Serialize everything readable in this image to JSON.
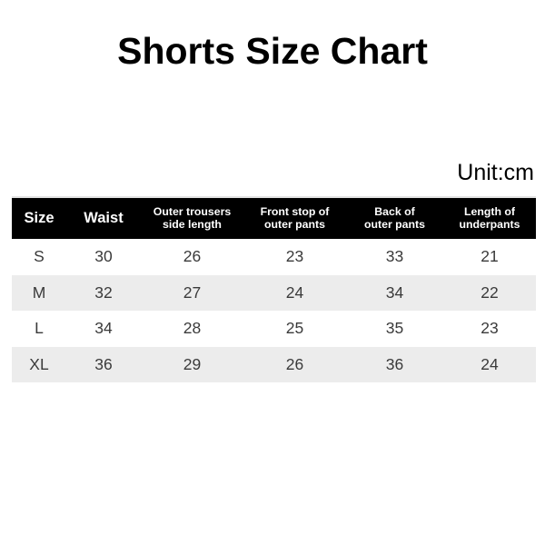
{
  "title": "Shorts Size Chart",
  "unit_note": "Unit:cm",
  "colors": {
    "header_background": "#000000",
    "header_text": "#ffffff",
    "stripe_row": "#ececec",
    "plain_row": "#ffffff",
    "data_text": "#3a3a3a",
    "title_text": "#000000",
    "top_rule": "#e3e3e3"
  },
  "table": {
    "headers": [
      {
        "lines": [
          "Size"
        ],
        "size": "big"
      },
      {
        "lines": [
          "Waist"
        ],
        "size": "big"
      },
      {
        "lines": [
          "Outer trousers",
          "side length"
        ],
        "size": "small"
      },
      {
        "lines": [
          "Front stop of",
          "outer pants"
        ],
        "size": "small"
      },
      {
        "lines": [
          "Back of",
          "outer pants"
        ],
        "size": "small"
      },
      {
        "lines": [
          "Length of",
          "underpants"
        ],
        "size": "small"
      }
    ],
    "rows": [
      {
        "cells": [
          "S",
          "30",
          "26",
          "23",
          "33",
          "21"
        ],
        "striped": false
      },
      {
        "cells": [
          "M",
          "32",
          "27",
          "24",
          "34",
          "22"
        ],
        "striped": true
      },
      {
        "cells": [
          "L",
          "34",
          "28",
          "25",
          "35",
          "23"
        ],
        "striped": false
      },
      {
        "cells": [
          "XL",
          "36",
          "29",
          "26",
          "36",
          "24"
        ],
        "striped": true
      }
    ]
  },
  "chart_data": {
    "type": "table",
    "title": "Shorts Size Chart",
    "subtitle": "Unit:cm",
    "units": "cm",
    "columns": [
      "Size",
      "Waist",
      "Outer trousers side length",
      "Front stop of outer pants",
      "Back of outer pants",
      "Length of underpants"
    ],
    "categories": [
      "S",
      "M",
      "L",
      "XL"
    ],
    "series": [
      {
        "name": "Waist",
        "values": [
          30,
          32,
          34,
          36
        ]
      },
      {
        "name": "Outer trousers side length",
        "values": [
          26,
          27,
          28,
          29
        ]
      },
      {
        "name": "Front stop of outer pants",
        "values": [
          23,
          24,
          25,
          26
        ]
      },
      {
        "name": "Back of outer pants",
        "values": [
          33,
          34,
          35,
          36
        ]
      },
      {
        "name": "Length of underpants",
        "values": [
          21,
          22,
          23,
          24
        ]
      }
    ],
    "rows": [
      [
        "S",
        30,
        26,
        23,
        33,
        21
      ],
      [
        "M",
        32,
        27,
        24,
        34,
        22
      ],
      [
        "L",
        34,
        28,
        25,
        35,
        23
      ],
      [
        "XL",
        36,
        29,
        26,
        36,
        24
      ]
    ]
  }
}
